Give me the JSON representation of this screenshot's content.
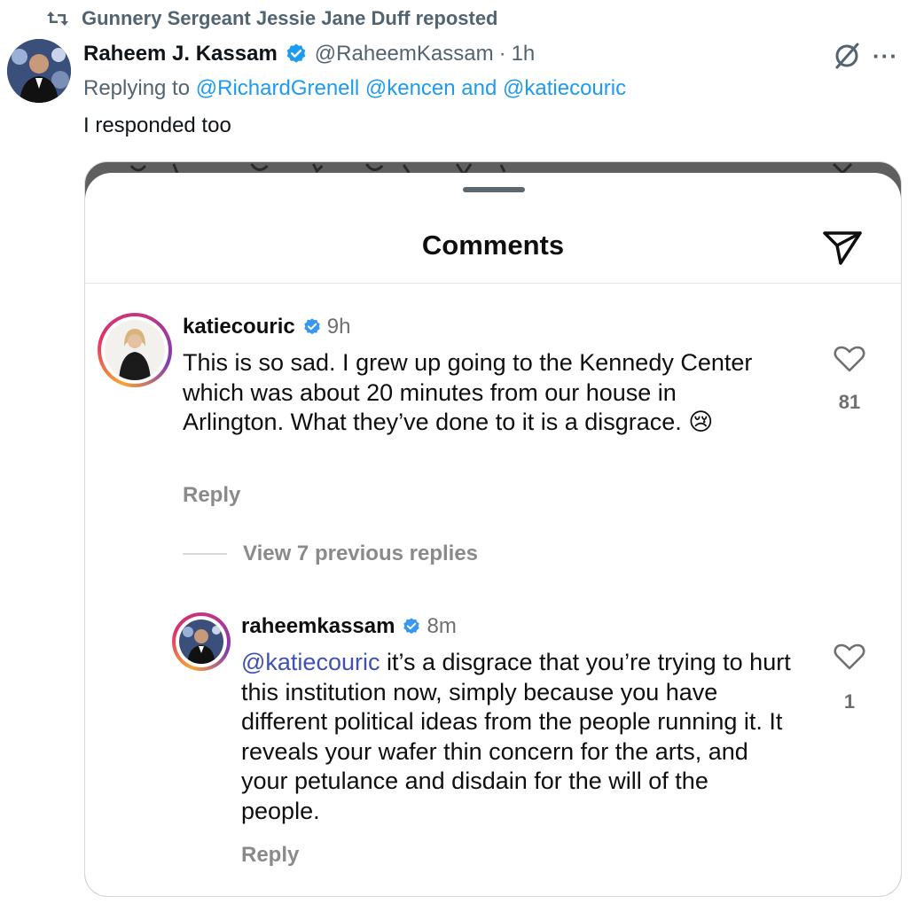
{
  "repost": {
    "text": "Gunnery Sergeant Jessie Jane Duff reposted",
    "icon": "repost-icon"
  },
  "tweet": {
    "display_name": "Raheem J. Kassam",
    "handle": "@RaheemKassam",
    "separator": "·",
    "time": "1h",
    "replying_prefix": "Replying to ",
    "replying_mentions": [
      "@RichardGrenell",
      "@kencen",
      "@katiecouric"
    ],
    "replying_joiner_1": " ",
    "replying_joiner_2": " and ",
    "text": "I responded too",
    "verified_color": "#1d9bf0",
    "more_label": "···"
  },
  "embedded_screenshot": {
    "title": "Comments",
    "comments": [
      {
        "username": "katiecouric",
        "ago": "9h",
        "text": "This is so sad. I grew up going to the Kennedy Center which was about 20 minutes from our house in Arlington.  What they’ve done to it is a disgrace. 😢",
        "reply_label": "Reply",
        "likes": "81"
      },
      {
        "username": "raheemkassam",
        "ago": "8m",
        "mention": "@katiecouric",
        "text": " it’s a disgrace that you’re trying to hurt this institution now, simply because you have different political ideas from the people running it. It reveals your wafer thin concern for the arts, and your petulance and disdain for the will of the people.",
        "reply_label": "Reply",
        "likes": "1"
      }
    ],
    "view_replies": "View 7 previous replies"
  },
  "colors": {
    "twitter_blue": "#1d9bf0",
    "ig_mention": "#3f51b5",
    "secondary_text": "#536471"
  }
}
